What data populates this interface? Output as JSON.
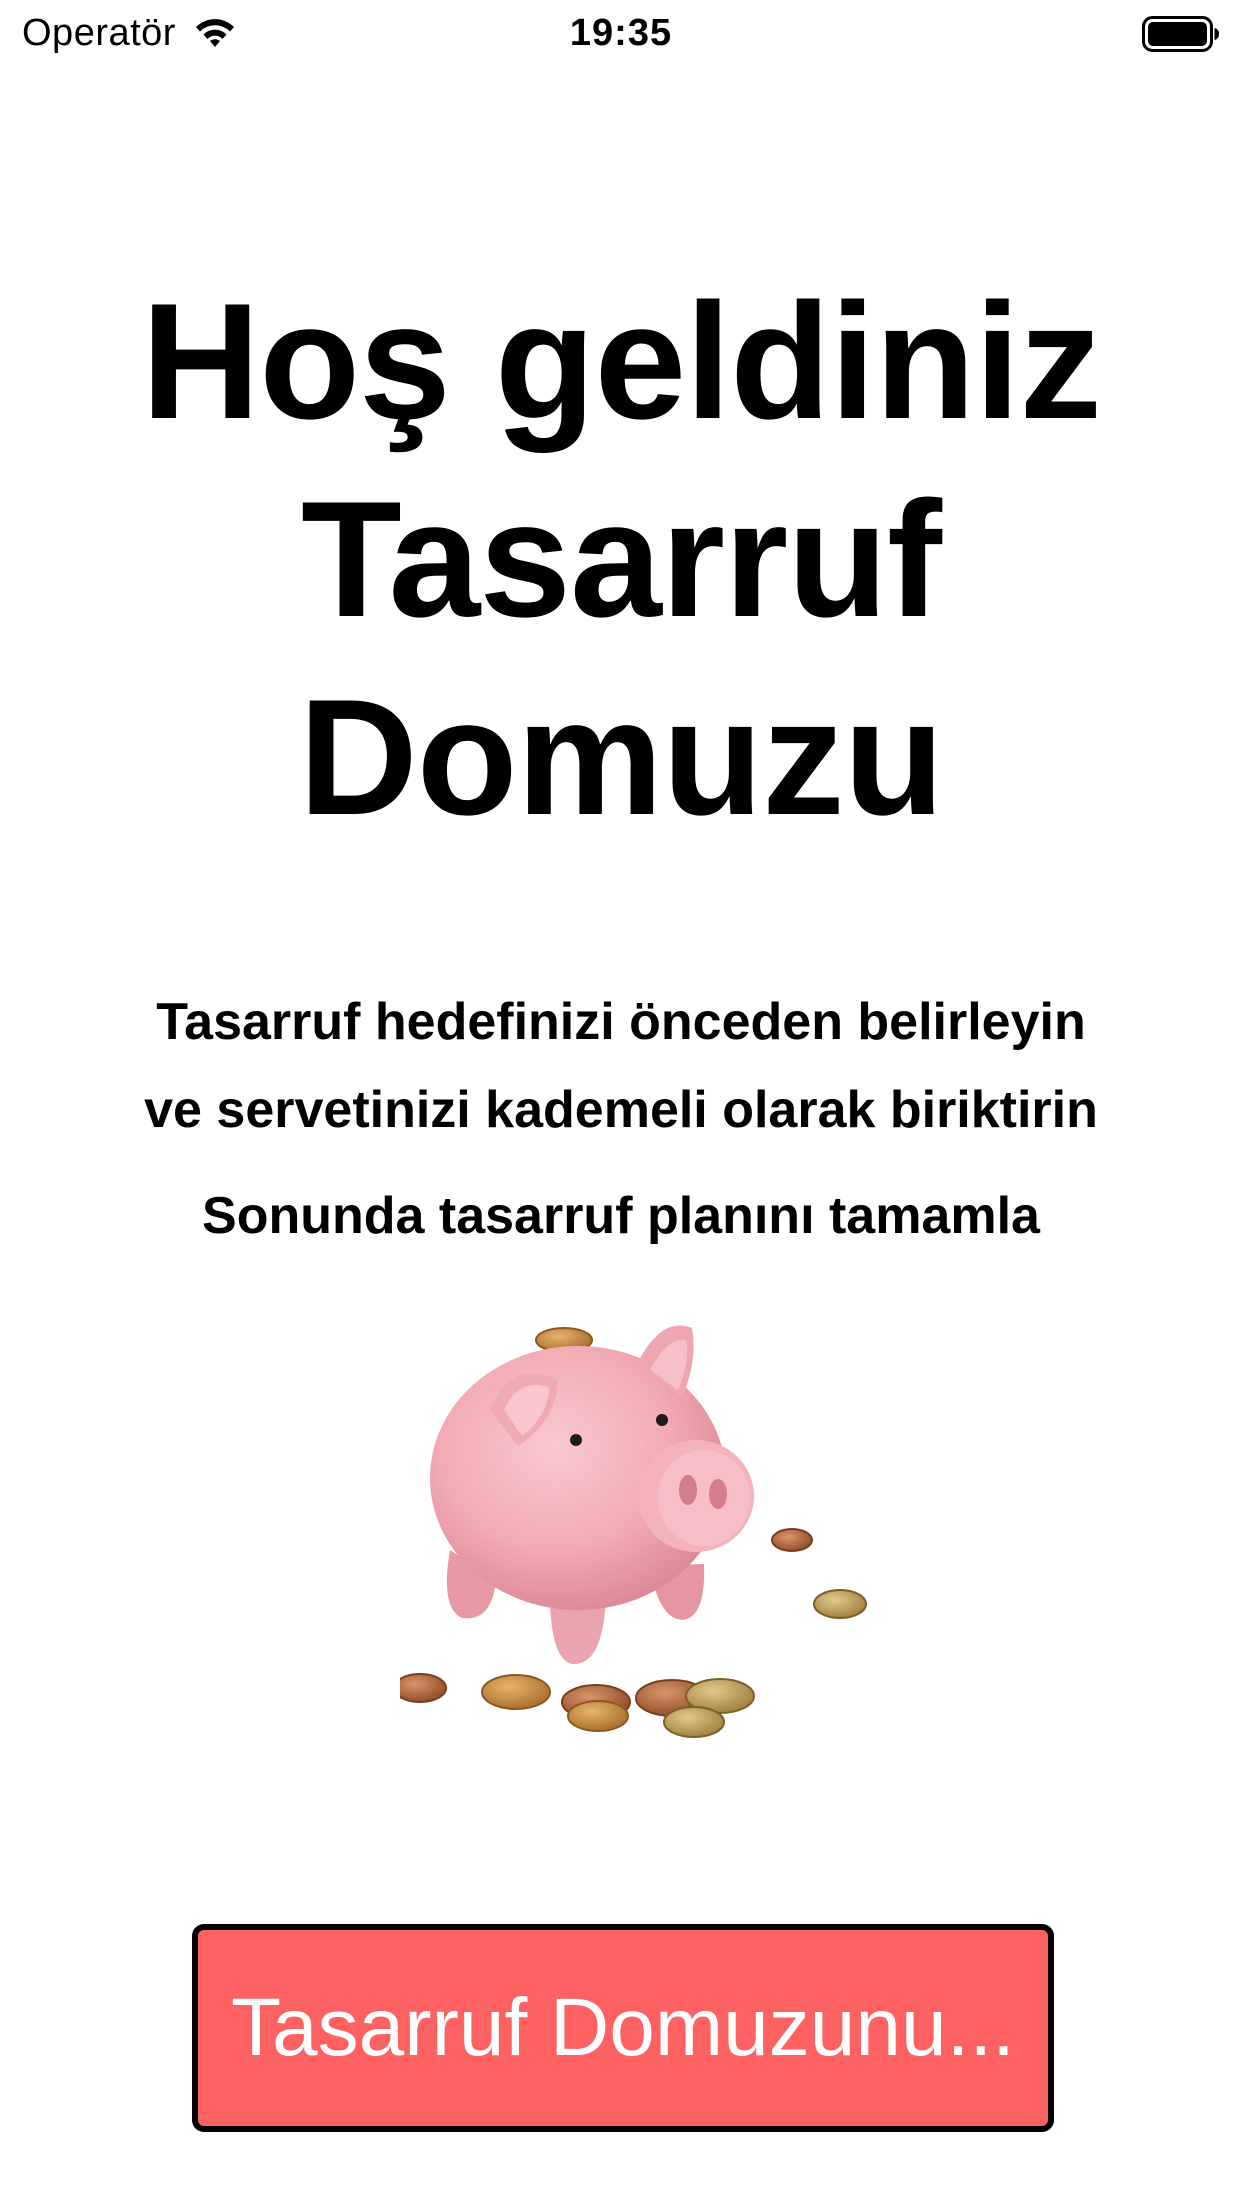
{
  "status_bar": {
    "carrier": "Operatör",
    "time": "19:35",
    "wifi_icon": "wifi-icon",
    "battery_icon": "battery-icon",
    "battery_level": 1.0
  },
  "welcome": {
    "title_line_1": "Hoş geldiniz",
    "title_line_2": "Tasarruf",
    "title_line_3": "Domuzu"
  },
  "description": {
    "line_1": "Tasarruf hedefinizi önceden belirleyin",
    "line_2": "ve servetinizi kademeli olarak biriktirin",
    "final_note": "Sonunda tasarruf planını tamamla"
  },
  "illustration": {
    "icon": "piggy-bank-icon"
  },
  "primary_button": {
    "label": "Tasarruf Domuzunu...",
    "background": "#fe6161",
    "border_color": "#000000",
    "text_color": "#ffffff"
  }
}
